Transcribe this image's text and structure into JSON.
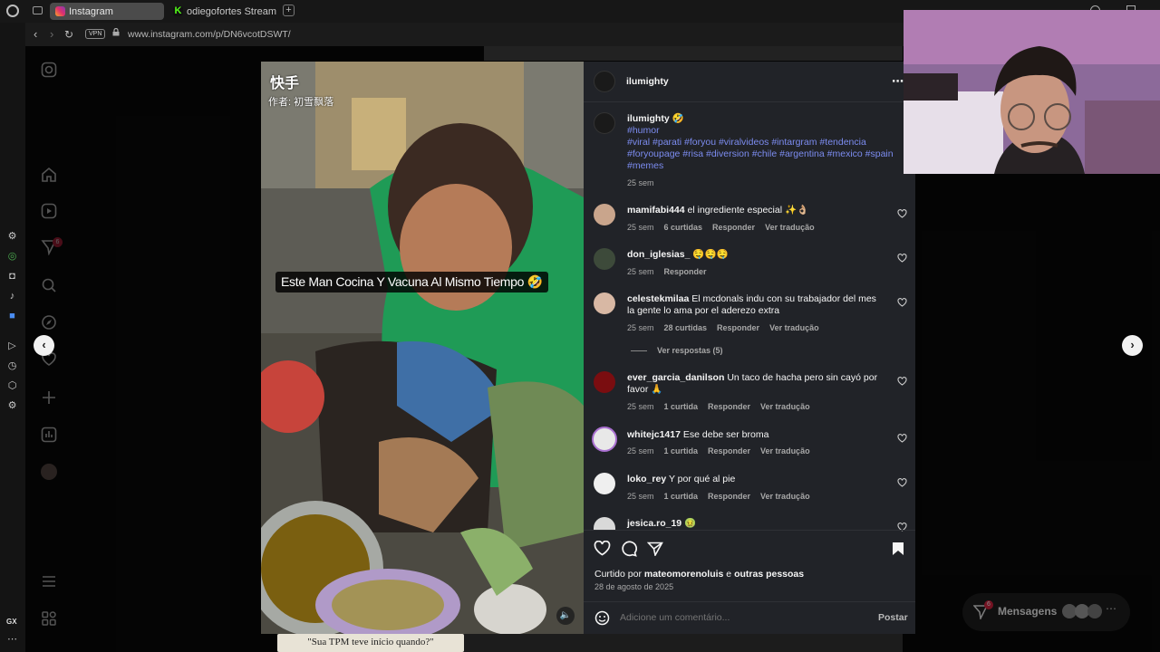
{
  "browser": {
    "tabs": [
      {
        "label": "Instagram",
        "active": true
      },
      {
        "label": "odiegofortes Stream - Wat",
        "active": false
      }
    ],
    "vpn_label": "VPN",
    "url": "www.instagram.com/p/DN6vcotDSWT/"
  },
  "opera_sidebar": {
    "gx_label": "GX",
    "notification_count": "6"
  },
  "video": {
    "watermark_app": "快手",
    "watermark_author": "作者: 初雪飘落",
    "caption": "Este Man Cocina Y Vacuna  Al Mismo Tiempo 🤣",
    "bottom_caption": "\"Sua TPM teve início quando?\""
  },
  "post": {
    "author": "ilumighty",
    "caption_author": "ilumighty",
    "caption_emoji": "🤣",
    "caption_first_tag": "#humor",
    "caption_tags": "#viral #parati #foryou #viralvideos #intargram #tendencia #foryoupage #risa #diversion #chile #argentina #mexico #spain #memes",
    "caption_time": "25 sem",
    "comments": [
      {
        "user": "mamifabi444",
        "text": "el ingrediente especial ✨👌🏼",
        "time": "25 sem",
        "likes": "6 curtidas",
        "reply": "Responder",
        "translate": "Ver tradução"
      },
      {
        "user": "don_iglesias_",
        "text": "🤤🤤🤤",
        "time": "25 sem",
        "likes": "",
        "reply": "Responder",
        "translate": ""
      },
      {
        "user": "celestekmilaa",
        "text": "El mcdonals indu con su trabajador del mes la gente lo ama por el aderezo extra",
        "time": "25 sem",
        "likes": "28 curtidas",
        "reply": "Responder",
        "translate": "Ver tradução"
      },
      {
        "user": "ever_garcia_danilson",
        "text": "Un taco de hacha pero sin cayó por favor 🙏",
        "time": "25 sem",
        "likes": "1 curtida",
        "reply": "Responder",
        "translate": "Ver tradução"
      },
      {
        "user": "whitejc1417",
        "text": "Ese debe ser broma",
        "time": "25 sem",
        "likes": "1 curtida",
        "reply": "Responder",
        "translate": "Ver tradução"
      },
      {
        "user": "loko_rey",
        "text": "Y por qué al pie",
        "time": "25 sem",
        "likes": "1 curtida",
        "reply": "Responder",
        "translate": "Ver tradução"
      },
      {
        "user": "jesica.ro_19",
        "text": "🤢",
        "time": "",
        "likes": "",
        "reply": "",
        "translate": ""
      }
    ],
    "view_replies": "Ver respostas (5)",
    "liked_by_prefix": "Curtido por ",
    "liked_by_user": "mateomorenoluis",
    "liked_by_join": " e ",
    "liked_by_others": "outras pessoas",
    "date": "28 de agosto de 2025",
    "comment_placeholder": "Adicione um comentário...",
    "post_button": "Postar"
  },
  "messages": {
    "label": "Mensagens",
    "badge": "6"
  },
  "colors": {
    "panel_bg": "#212328",
    "hashtag": "#7c8cf0",
    "secondary_text": "#a8a8a8"
  }
}
